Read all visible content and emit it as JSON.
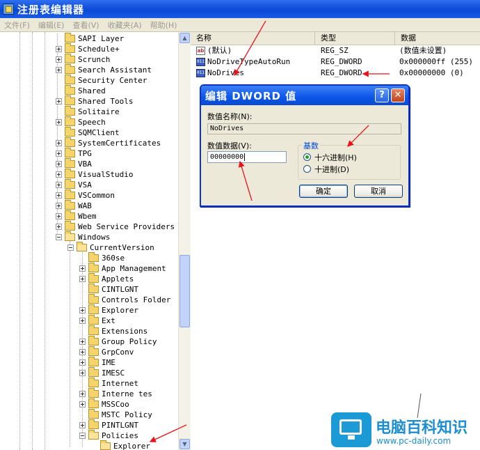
{
  "window": {
    "title": "注册表编辑器"
  },
  "menu": [
    "文件(F)",
    "编辑(E)",
    "查看(V)",
    "收藏夹(A)",
    "帮助(H)"
  ],
  "tree": [
    {
      "label": "SAPI Layer",
      "level": 0,
      "exp": "none",
      "open": false
    },
    {
      "label": "Schedule+",
      "level": 0,
      "exp": "plus",
      "open": false
    },
    {
      "label": "Scrunch",
      "level": 0,
      "exp": "plus",
      "open": false
    },
    {
      "label": "Search Assistant",
      "level": 0,
      "exp": "plus",
      "open": false
    },
    {
      "label": "Security Center",
      "level": 0,
      "exp": "none",
      "open": false
    },
    {
      "label": "Shared",
      "level": 0,
      "exp": "none",
      "open": false
    },
    {
      "label": "Shared Tools",
      "level": 0,
      "exp": "plus",
      "open": false
    },
    {
      "label": "Solitaire",
      "level": 0,
      "exp": "none",
      "open": false
    },
    {
      "label": "Speech",
      "level": 0,
      "exp": "plus",
      "open": false
    },
    {
      "label": "SQMClient",
      "level": 0,
      "exp": "none",
      "open": false
    },
    {
      "label": "SystemCertificates",
      "level": 0,
      "exp": "plus",
      "open": false
    },
    {
      "label": "TPG",
      "level": 0,
      "exp": "plus",
      "open": false
    },
    {
      "label": "VBA",
      "level": 0,
      "exp": "plus",
      "open": false
    },
    {
      "label": "VisualStudio",
      "level": 0,
      "exp": "plus",
      "open": false
    },
    {
      "label": "VSA",
      "level": 0,
      "exp": "plus",
      "open": false
    },
    {
      "label": "VSCommon",
      "level": 0,
      "exp": "plus",
      "open": false
    },
    {
      "label": "WAB",
      "level": 0,
      "exp": "plus",
      "open": false
    },
    {
      "label": "Wbem",
      "level": 0,
      "exp": "plus",
      "open": false
    },
    {
      "label": "Web Service Providers",
      "level": 0,
      "exp": "plus",
      "open": false
    },
    {
      "label": "Windows",
      "level": 0,
      "exp": "minus",
      "open": true
    },
    {
      "label": "CurrentVersion",
      "level": 1,
      "exp": "minus",
      "open": true
    },
    {
      "label": "360se",
      "level": 2,
      "exp": "none",
      "open": false
    },
    {
      "label": "App Management",
      "level": 2,
      "exp": "plus",
      "open": false
    },
    {
      "label": "Applets",
      "level": 2,
      "exp": "plus",
      "open": false
    },
    {
      "label": "CINTLGNT",
      "level": 2,
      "exp": "none",
      "open": false
    },
    {
      "label": "Controls Folder",
      "level": 2,
      "exp": "none",
      "open": false
    },
    {
      "label": "Explorer",
      "level": 2,
      "exp": "plus",
      "open": false
    },
    {
      "label": "Ext",
      "level": 2,
      "exp": "plus",
      "open": false
    },
    {
      "label": "Extensions",
      "level": 2,
      "exp": "none",
      "open": false
    },
    {
      "label": "Group Policy",
      "level": 2,
      "exp": "plus",
      "open": false
    },
    {
      "label": "GrpConv",
      "level": 2,
      "exp": "plus",
      "open": false
    },
    {
      "label": "IME",
      "level": 2,
      "exp": "plus",
      "open": false
    },
    {
      "label": "IMESC",
      "level": 2,
      "exp": "plus",
      "open": false
    },
    {
      "label": "Internet",
      "level": 2,
      "exp": "none",
      "open": false
    },
    {
      "label": "Interne tes",
      "level": 2,
      "exp": "plus",
      "open": false
    },
    {
      "label": "MSSCoo",
      "level": 2,
      "exp": "plus",
      "open": false
    },
    {
      "label": "MSTC Policy",
      "level": 2,
      "exp": "none",
      "open": false
    },
    {
      "label": "PINTLGNT",
      "level": 2,
      "exp": "plus",
      "open": false
    },
    {
      "label": "Policies",
      "level": 2,
      "exp": "minus",
      "open": true
    },
    {
      "label": "Explorer",
      "level": 3,
      "exp": "none",
      "open": true
    }
  ],
  "list": {
    "headers": [
      "名称",
      "类型",
      "数据"
    ],
    "rows": [
      {
        "icon": "ab",
        "name": "(默认)",
        "type": "REG_SZ",
        "data": "(数值未设置)"
      },
      {
        "icon": "bin",
        "name": "NoDriveTypeAutoRun",
        "type": "REG_DWORD",
        "data": "0x000000ff (255)"
      },
      {
        "icon": "bin",
        "name": "NoDrives",
        "type": "REG_DWORD",
        "data": "0x00000000 (0)"
      }
    ]
  },
  "dialog": {
    "title": "编辑 DWORD 值",
    "help": "?",
    "close": "✕",
    "name_label": "数值名称(N):",
    "name_value": "NoDrives",
    "data_label": "数值数据(V):",
    "data_value": "00000000",
    "base_label": "基数",
    "hex_label": "十六进制(H)",
    "dec_label": "十进制(D)",
    "selected_base": "hex",
    "ok_label": "确定",
    "cancel_label": "取消"
  },
  "watermark": {
    "title": "电脑百科知识",
    "url": "www.pc-daily.com"
  },
  "colors": {
    "accent": "#0b56e8",
    "annotation": "#e8131b",
    "watermark": "#1b9ad6"
  }
}
